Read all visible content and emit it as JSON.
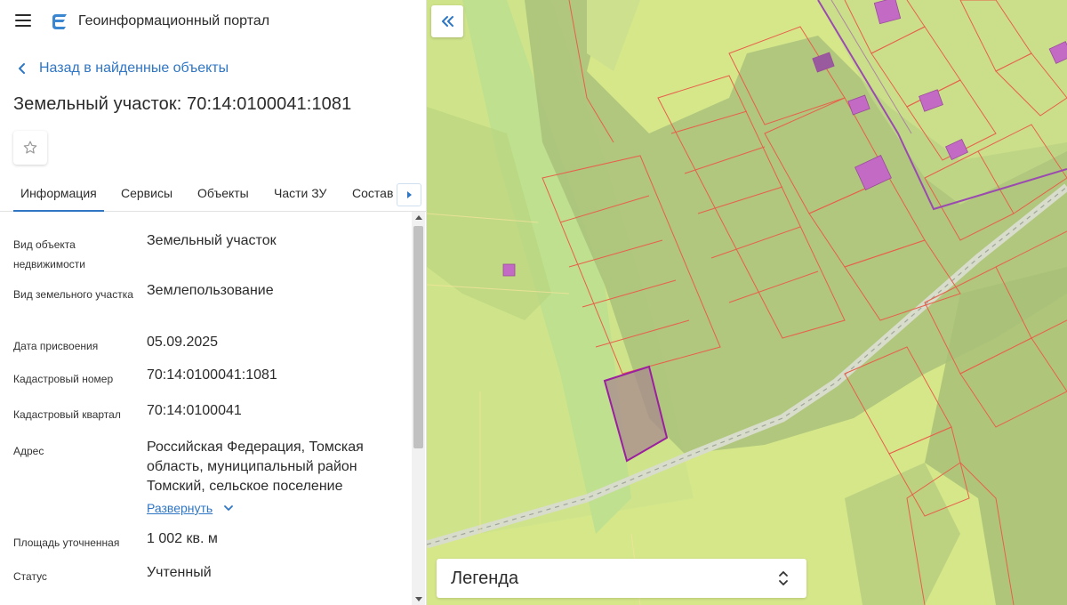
{
  "app": {
    "title": "Геоинформационный портал"
  },
  "nav": {
    "back_label": "Назад в найденные объекты"
  },
  "object": {
    "title": "Земельный участок: 70:14:0100041:1081"
  },
  "tabs": [
    {
      "label": "Информация",
      "active": true
    },
    {
      "label": "Сервисы",
      "active": false
    },
    {
      "label": "Объекты",
      "active": false
    },
    {
      "label": "Части ЗУ",
      "active": false
    },
    {
      "label": "Состав",
      "active": false
    }
  ],
  "info": {
    "rows": [
      {
        "label": "Вид объекта недвижимости",
        "value": "Земельный участок"
      },
      {
        "label": "Вид земельного участка",
        "value": "Землепользование"
      },
      {
        "label": "Дата присвоения",
        "value": "05.09.2025"
      },
      {
        "label": "Кадастровый номер",
        "value": "70:14:0100041:1081"
      },
      {
        "label": "Кадастровый квартал",
        "value": "70:14:0100041"
      },
      {
        "label": "Адрес",
        "value": "Российская Федерация, Томская область, муниципальный район Томский, сельское поселение"
      },
      {
        "label": "Площадь уточненная",
        "value": "1 002 кв. м"
      },
      {
        "label": "Статус",
        "value": "Учтенный"
      }
    ],
    "expand_label": "Развернуть"
  },
  "map": {
    "legend_label": "Легенда"
  },
  "colors": {
    "accent": "#2f76c4",
    "map_base": "#d7e88a",
    "parcel_border": "#e8604a",
    "selected_parcel": "#9b1fa0",
    "building": "#c36bc4"
  },
  "icons": {
    "menu": "hamburger-icon",
    "logo": "portal-logo-icon",
    "back": "chevron-left-icon",
    "favorite": "star-icon",
    "tabs_next": "triangle-right-icon",
    "expand": "chevron-down-icon",
    "collapse_panel": "double-chevron-left-icon",
    "legend_toggle": "chevron-up-down-icon"
  }
}
